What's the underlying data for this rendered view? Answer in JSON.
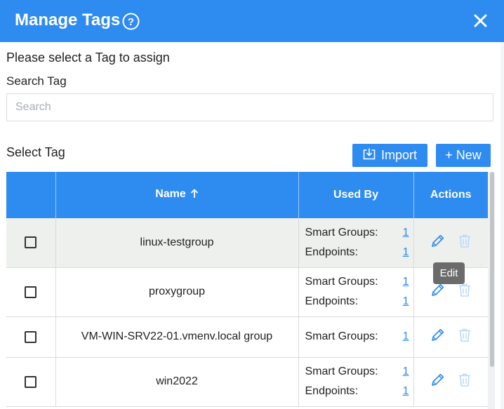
{
  "header": {
    "title": "Manage Tags",
    "bg_color": "#2E8BF0"
  },
  "instruction": "Please select a Tag to assign",
  "search": {
    "label": "Search Tag",
    "placeholder": "Search",
    "value": ""
  },
  "select_label": "Select Tag",
  "buttons": {
    "import_label": "Import",
    "new_label": "+ New"
  },
  "table": {
    "columns": {
      "name": "Name",
      "used_by": "Used By",
      "actions": "Actions"
    },
    "sort": {
      "column": "Name",
      "direction": "ascending"
    },
    "rows": [
      {
        "name": "linux-testgroup",
        "selected": true,
        "usage": [
          {
            "label": "Smart Groups:",
            "count": "1"
          },
          {
            "label": "Endpoints:",
            "count": "1"
          }
        ]
      },
      {
        "name": "proxygroup",
        "selected": false,
        "usage": [
          {
            "label": "Smart Groups:",
            "count": "1"
          },
          {
            "label": "Endpoints:",
            "count": "1"
          }
        ]
      },
      {
        "name": "VM-WIN-SRV22-01.vmenv.local group",
        "selected": false,
        "usage": [
          {
            "label": "Smart Groups:",
            "count": "1"
          }
        ]
      },
      {
        "name": "win2022",
        "selected": false,
        "usage": [
          {
            "label": "Smart Groups:",
            "count": "1"
          },
          {
            "label": "Endpoints:",
            "count": "1"
          }
        ]
      }
    ]
  },
  "tooltip": "Edit",
  "icons": {
    "help": "help-icon",
    "close": "close-icon",
    "import": "import-icon",
    "sort": "sort-arrow-up-icon",
    "edit": "pencil-icon",
    "delete": "trash-icon"
  }
}
